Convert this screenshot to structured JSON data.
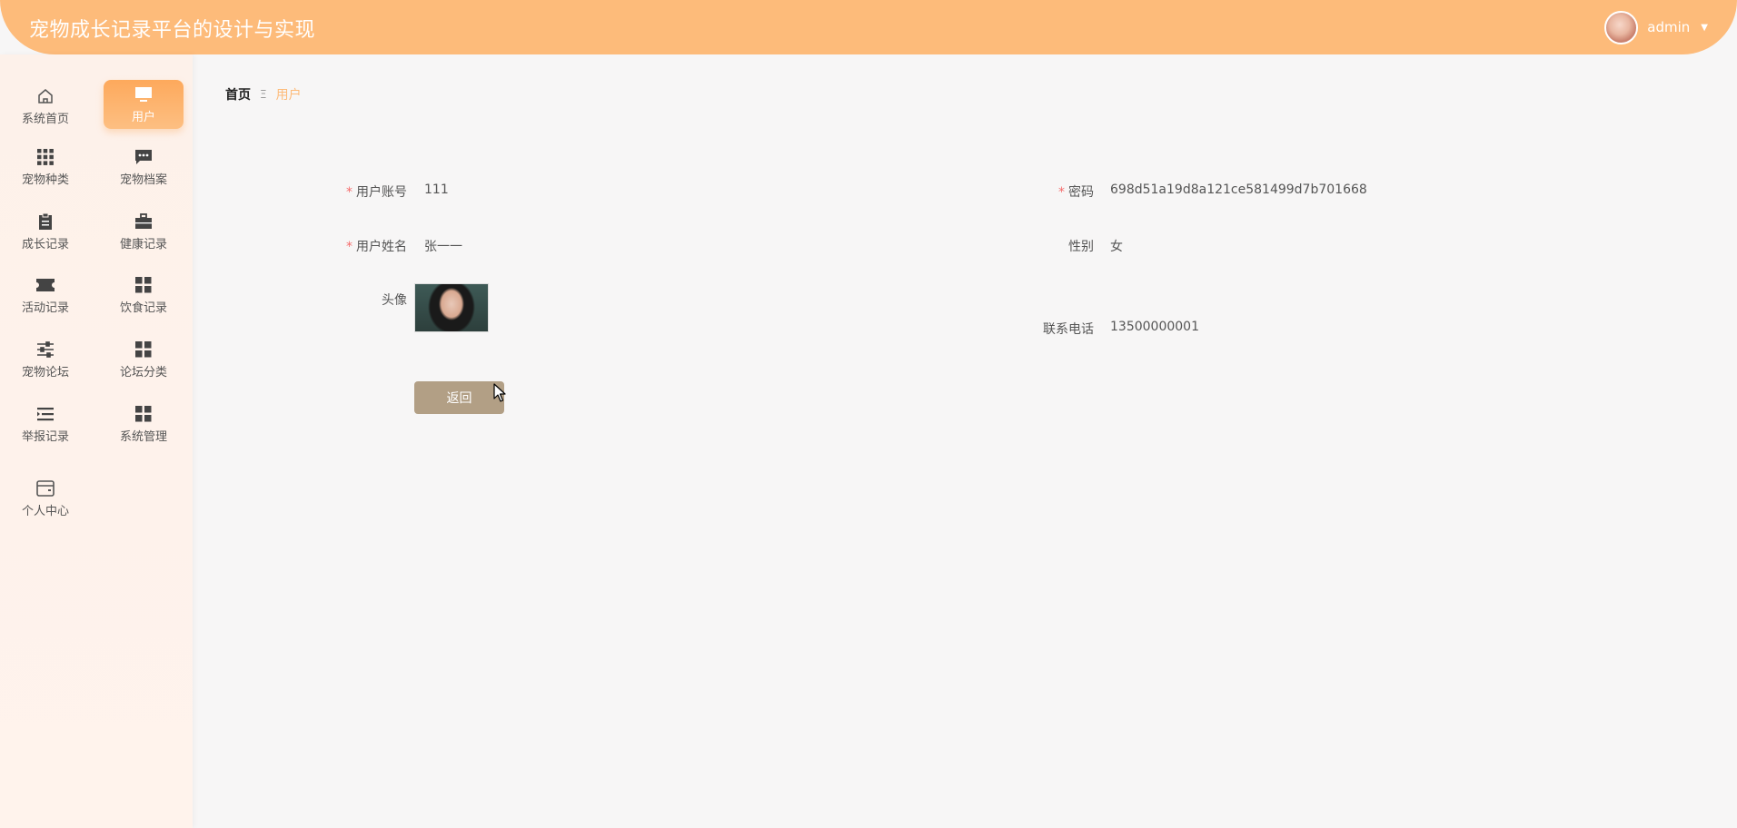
{
  "header": {
    "title": "宠物成长记录平台的设计与实现",
    "username": "admin"
  },
  "sidebar": {
    "items": [
      {
        "label": "系统首页",
        "icon": "home-icon"
      },
      {
        "label": "用户",
        "icon": "monitor-icon",
        "active": true
      },
      {
        "label": "宠物种类",
        "icon": "grid-icon"
      },
      {
        "label": "宠物档案",
        "icon": "chat-icon"
      },
      {
        "label": "成长记录",
        "icon": "clipboard-icon"
      },
      {
        "label": "健康记录",
        "icon": "briefcase-icon"
      },
      {
        "label": "活动记录",
        "icon": "ticket-icon"
      },
      {
        "label": "饮食记录",
        "icon": "apps-icon"
      },
      {
        "label": "宠物论坛",
        "icon": "sliders-icon"
      },
      {
        "label": "论坛分类",
        "icon": "apps-icon"
      },
      {
        "label": "举报记录",
        "icon": "list-icon"
      },
      {
        "label": "系统管理",
        "icon": "apps-icon"
      },
      {
        "label": "个人中心",
        "icon": "card-icon"
      }
    ]
  },
  "breadcrumb": {
    "home": "首页",
    "separator": "Ξ",
    "current": "用户"
  },
  "form": {
    "account_label": "用户账号",
    "account_value": "111",
    "password_label": "密码",
    "password_value": "698d51a19d8a121ce581499d7b701668",
    "name_label": "用户姓名",
    "name_value": "张一一",
    "gender_label": "性别",
    "gender_value": "女",
    "avatar_label": "头像",
    "phone_label": "联系电话",
    "phone_value": "13500000001",
    "back_button": "返回"
  },
  "colors": {
    "accent": "#fdbb7a",
    "active_menu": "#fda95c",
    "button": "#b29f85",
    "required": "#f56c6c"
  }
}
